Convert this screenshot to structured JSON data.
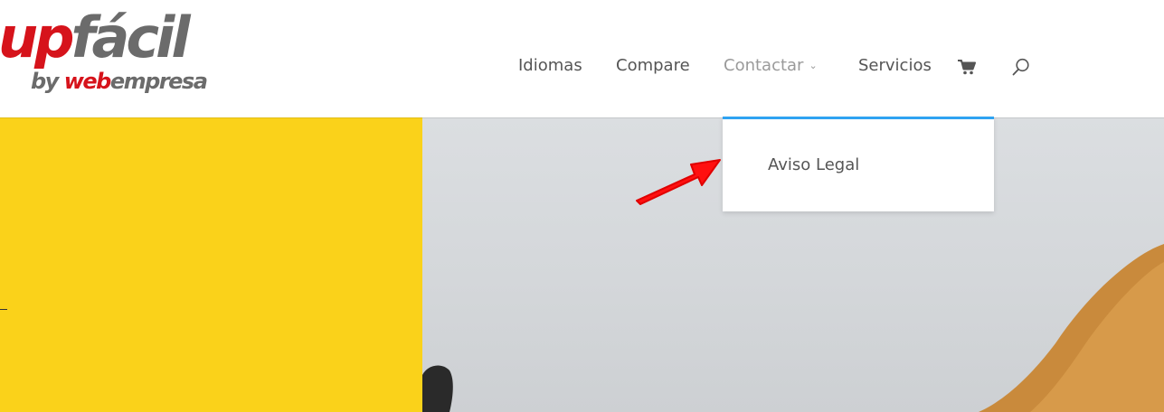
{
  "logo": {
    "main_part1": "up",
    "main_part2": "fácil",
    "sub_by": "by ",
    "sub_web": "web",
    "sub_empresa": "empresa"
  },
  "nav": {
    "items": [
      {
        "label": "Idiomas"
      },
      {
        "label": "Compare"
      },
      {
        "label": "Contactar",
        "active": true,
        "chevron": "⌄"
      },
      {
        "label": "Servicios"
      }
    ],
    "cart_icon": "cart-icon",
    "search_icon": "search-icon"
  },
  "dropdown": {
    "items": [
      {
        "label": "Aviso Legal"
      }
    ]
  },
  "colors": {
    "brand_red": "#d6131b",
    "brand_grey": "#6b6b6b",
    "nav_text": "#555555",
    "nav_active": "#9a9a9a",
    "dropdown_accent": "#2ea3f2",
    "hero_yellow": "#fad21a",
    "annotation_arrow": "#ff1010"
  }
}
